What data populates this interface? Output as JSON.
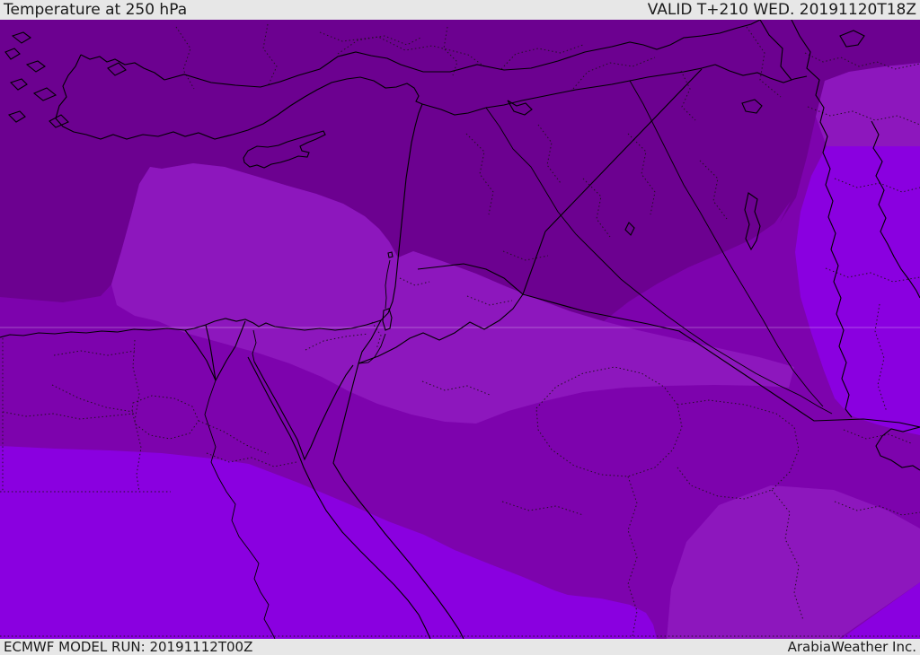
{
  "header": {
    "title": "Temperature at 250 hPa",
    "valid_label": "VALID T+210 WED. 20191120T18Z"
  },
  "footer": {
    "model_run_label": "ECMWF MODEL RUN: 20191112T00Z",
    "credit": "ArabiaWeather Inc."
  },
  "map": {
    "colors": {
      "bar_bg": "#e7e7e7",
      "bar_text": "#1b1b1b",
      "zone_coldest": "#6c0190",
      "zone_cold": "#7d03ad",
      "zone_mild": "#8d17bd",
      "zone_warm": "#8a00e0",
      "coastline": "#000000",
      "admin_boundary": "#241024",
      "gridline": "rgba(255,255,255,0.30)"
    }
  }
}
